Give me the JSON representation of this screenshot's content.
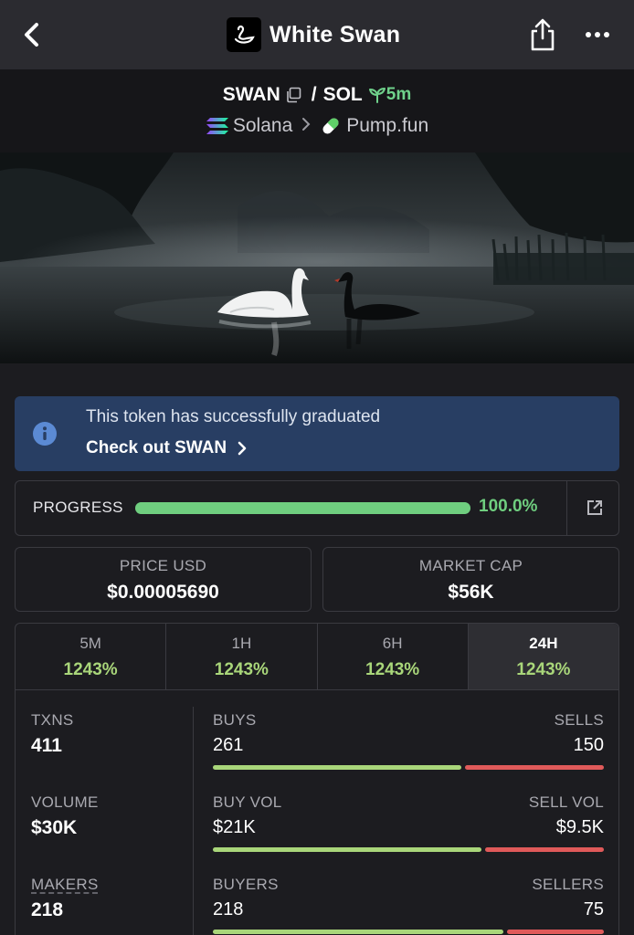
{
  "header": {
    "title": "White Swan"
  },
  "pair": {
    "base": "SWAN",
    "separator": "/",
    "quote": "SOL",
    "age": "5m",
    "chain": "Solana",
    "dex": "Pump.fun"
  },
  "notice": {
    "message": "This token has successfully graduated",
    "link": "Check out SWAN"
  },
  "progress": {
    "label": "PROGRESS",
    "percent": 100.0,
    "value_text": "100.0%"
  },
  "stats": {
    "price_label": "PRICE USD",
    "price_value": "$0.00005690",
    "mcap_label": "MARKET CAP",
    "mcap_value": "$56K"
  },
  "timeframes": [
    {
      "name": "5M",
      "change": "1243%"
    },
    {
      "name": "1H",
      "change": "1243%"
    },
    {
      "name": "6H",
      "change": "1243%"
    },
    {
      "name": "24H",
      "change": "1243%",
      "active": true
    }
  ],
  "metrics": [
    {
      "label": "TXNS",
      "value": "411",
      "left_label": "BUYS",
      "left_value": "261",
      "right_label": "SELLS",
      "right_value": "150",
      "buy_fraction": 0.635
    },
    {
      "label": "VOLUME",
      "value": "$30K",
      "left_label": "BUY VOL",
      "left_value": "$21K",
      "right_label": "SELL VOL",
      "right_value": "$9.5K",
      "buy_fraction": 0.688
    },
    {
      "label": "MAKERS",
      "value": "218",
      "left_label": "BUYERS",
      "left_value": "218",
      "right_label": "SELLERS",
      "right_value": "75",
      "buy_fraction": 0.744
    }
  ],
  "colors": {
    "accent_green": "#6fce7f",
    "change_green": "#a9d67a",
    "sell_red": "#e05a5a",
    "notice_bg": "#283e63"
  },
  "icons": [
    "back-icon",
    "swan-logo-icon",
    "share-icon",
    "more-icon",
    "copy-icon",
    "sprout-icon",
    "solana-icon",
    "chevron-right-icon",
    "pill-icon",
    "info-icon",
    "external-link-icon"
  ]
}
